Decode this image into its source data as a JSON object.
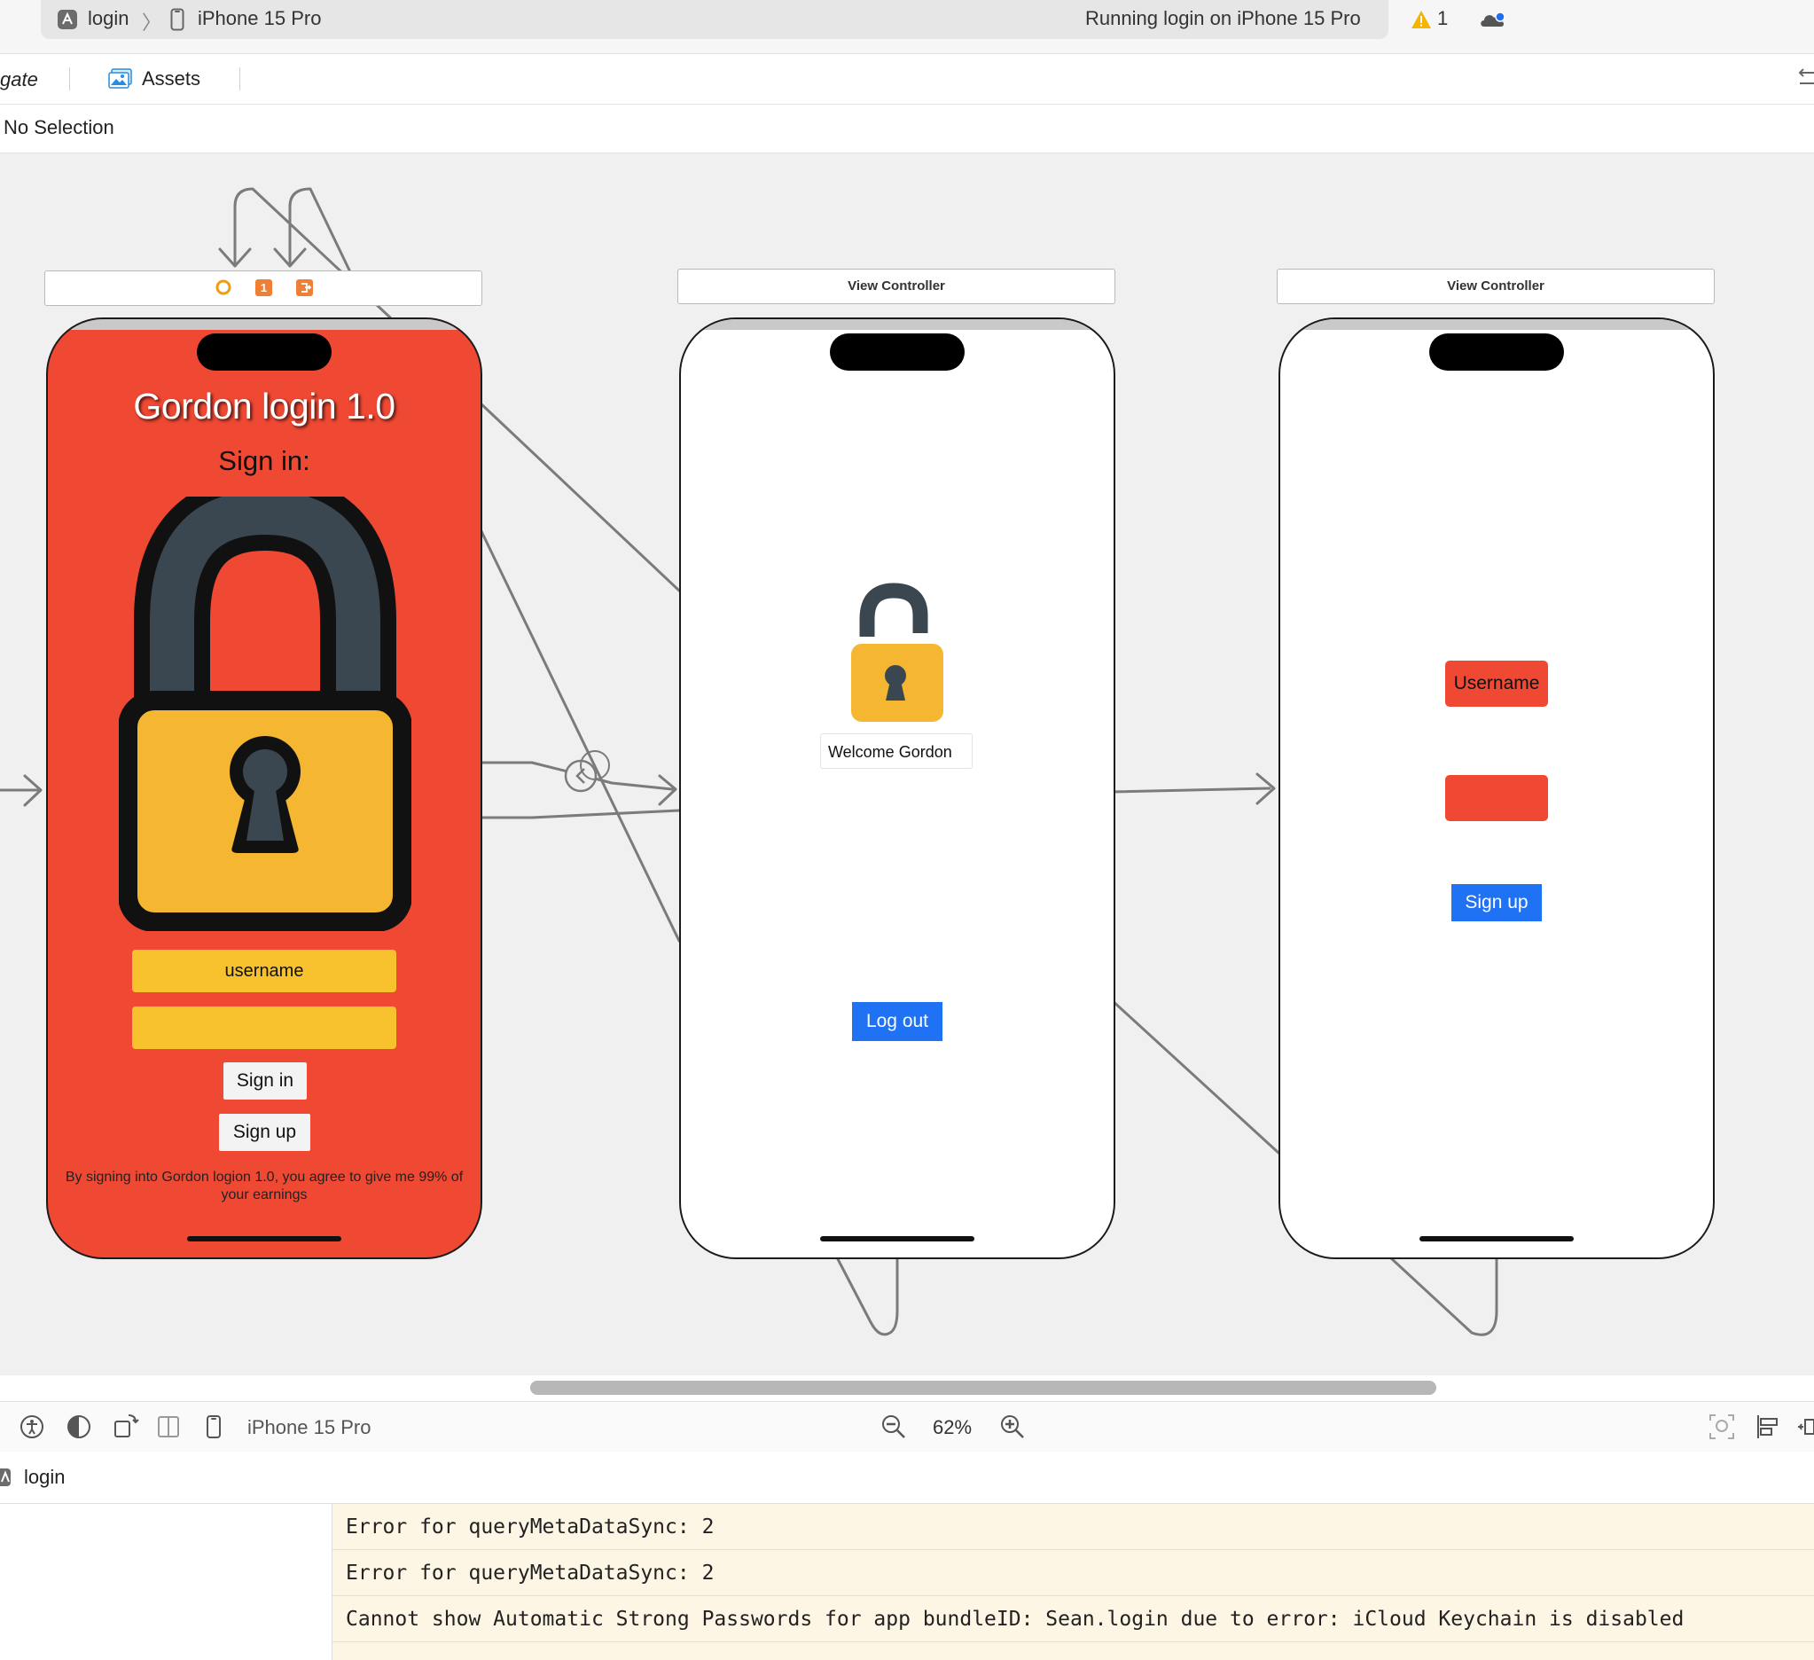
{
  "toolbar": {
    "breadcrumb_project": "login",
    "breadcrumb_device": "iPhone 15 Pro",
    "status": "Running login on iPhone 15 Pro",
    "warning_count": "1"
  },
  "tabs": {
    "partial_tab": "gate",
    "assets": "Assets"
  },
  "jumpbar": {
    "selection": "No Selection"
  },
  "canvas": {
    "scene_login": {
      "title": "Gordon login 1.0",
      "subtitle": "Sign in:",
      "username_field": "username",
      "password_field": "",
      "signin_button": "Sign in",
      "signup_button": "Sign up",
      "terms": "By signing into Gordon logion 1.0, you agree to give me 99% of your earnings",
      "header_badge": "1"
    },
    "scene_welcome": {
      "header": "View Controller",
      "welcome_label": "Welcome Gordon",
      "logout_button": "Log out"
    },
    "scene_signup": {
      "header": "View Controller",
      "username_field": "Username",
      "password_field": "",
      "signup_button": "Sign up"
    },
    "colors": {
      "login_background": "#ef4833",
      "field_yellow": "#f7c22e",
      "button_blue": "#1f72f3",
      "lock_body": "#f5b731",
      "lock_shackle": "#3b4750"
    }
  },
  "canvas_toolbar": {
    "device": "iPhone 15 Pro",
    "zoom": "62%"
  },
  "debug": {
    "target": "login",
    "console_lines": [
      "Error for queryMetaDataSync: 2",
      "Error for queryMetaDataSync: 2",
      "Cannot show Automatic Strong Passwords for app bundleID: Sean.login due to error: iCloud Keychain is disabled"
    ]
  },
  "icons": [
    "app-icon",
    "iphone-icon",
    "warning-icon",
    "cloud-icon",
    "assets-icon",
    "split-toggle-icon",
    "accessibility-icon",
    "appearance-icon",
    "orientation-icon",
    "layout-icon",
    "device-icon",
    "zoom-out-icon",
    "zoom-in-icon",
    "update-frames-icon",
    "align-icon",
    "pin-icon",
    "lock-closed-icon",
    "lock-open-icon",
    "entry-point-arrow",
    "segue-icon"
  ]
}
